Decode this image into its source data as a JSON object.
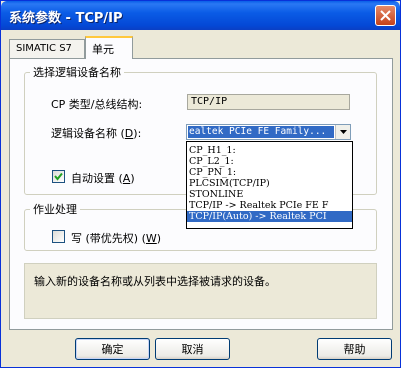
{
  "window": {
    "title": "系统参数 - TCP/IP",
    "close_icon": "close-icon"
  },
  "tabs": [
    {
      "label": "SIMATIC S7",
      "active": false
    },
    {
      "label": "单元",
      "active": true
    }
  ],
  "device_group": {
    "legend": "选择逻辑设备名称",
    "cp_type_label": "CP 类型/总线结构:",
    "cp_type_value": "TCP/IP",
    "logical_device_label_prefix": "逻辑设备名称 (",
    "logical_device_label_key": "D",
    "logical_device_label_suffix": "):",
    "logical_device_value": "ealtek PCIe FE Family...",
    "dropdown_options": [
      {
        "label": "CP_H1_1:",
        "selected": false
      },
      {
        "label": "CP_L2_1:",
        "selected": false
      },
      {
        "label": "CP_PN_1:",
        "selected": false
      },
      {
        "label": "PLCSIM(TCP/IP)",
        "selected": false
      },
      {
        "label": "STONLINE",
        "selected": false
      },
      {
        "label": "TCP/IP -> Realtek PCIe FE F",
        "selected": false
      },
      {
        "label": "TCP/IP(Auto) -> Realtek PCI",
        "selected": true
      }
    ],
    "auto_setting_label_prefix": "自动设置 (",
    "auto_setting_label_key": "A",
    "auto_setting_label_suffix": ")",
    "auto_setting_checked": true
  },
  "job_group": {
    "legend": "作业处理",
    "write_priority_label_prefix": "写 (带优先权) (",
    "write_priority_label_key": "W",
    "write_priority_label_suffix": ")",
    "write_priority_checked": false
  },
  "info_text": "输入新的设备名称或从列表中选择被请求的设备。",
  "buttons": {
    "ok": "确定",
    "cancel": "取消",
    "help": "帮助"
  },
  "colors": {
    "titlebar": "#0a5ee8",
    "selection": "#316ac5",
    "dialog_bg": "#ece9d8"
  }
}
